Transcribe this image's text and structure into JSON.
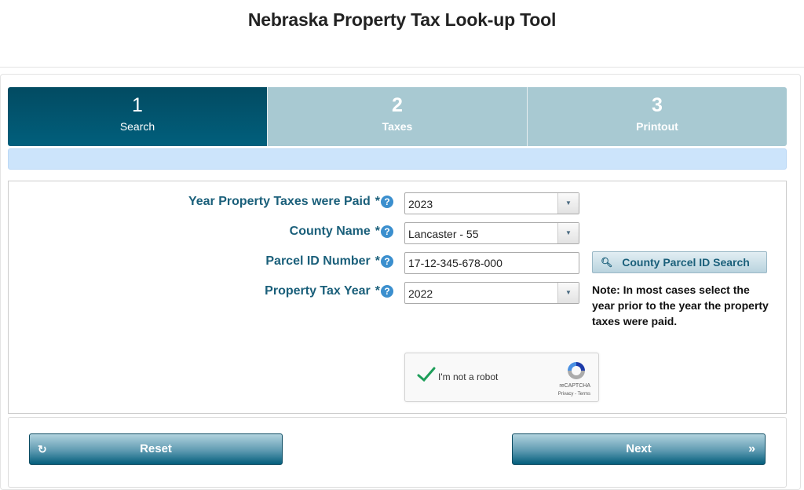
{
  "header": {
    "title": "Nebraska Property Tax Look-up Tool"
  },
  "steps": [
    {
      "number": "1",
      "label": "Search",
      "state": "active"
    },
    {
      "number": "2",
      "label": "Taxes",
      "state": "inactive"
    },
    {
      "number": "3",
      "label": "Printout",
      "state": "inactive"
    }
  ],
  "form": {
    "fields": [
      {
        "label": "Year Property Taxes were Paid",
        "required": "*",
        "help": "?",
        "type": "select",
        "value": "2023"
      },
      {
        "label": "County Name",
        "required": "*",
        "help": "?",
        "type": "select",
        "value": "Lancaster - 55"
      },
      {
        "label": "Parcel ID Number",
        "required": "*",
        "help": "?",
        "type": "text",
        "value": "17-12-345-678-000"
      },
      {
        "label": "Property Tax Year ",
        "required": "*",
        "help": "?",
        "type": "select",
        "value": "2022"
      }
    ],
    "parcel_search_button": {
      "label": "County Parcel ID Search",
      "icon": "search-icon"
    },
    "note": "Note: In most cases select the year prior to the year the property taxes were paid.",
    "recaptcha": {
      "label": "I'm not a robot",
      "brand": "reCAPTCHA",
      "links": "Privacy - Terms",
      "checked": true
    }
  },
  "footer": {
    "reset_button": {
      "label": "Reset",
      "icon": "refresh-icon"
    },
    "next_button": {
      "label": "Next",
      "icon": "double-chevron-right-icon"
    }
  },
  "colors": {
    "active_step": "#02556f",
    "inactive_step": "#a8c9d2",
    "label_text": "#1a5f7a",
    "help_icon": "#3b8fce",
    "progress_bar": "#cce4fb"
  }
}
